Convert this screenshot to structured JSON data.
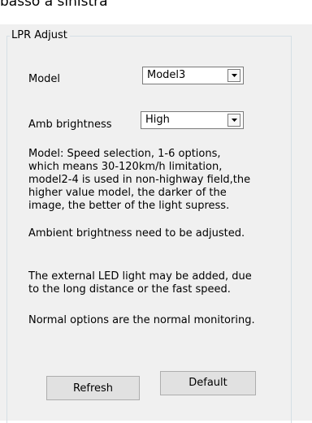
{
  "caption": "basso a sinistra",
  "group": {
    "title": "LPR Adjust"
  },
  "fields": {
    "model_label": "Model",
    "model_value": "Model3",
    "amb_label": "Amb brightness",
    "amb_value": "High"
  },
  "descriptions": {
    "model_lines": [
      "Model: Speed selection, 1-6 options,",
      "which means 30-120km/h limitation,",
      "model2-4 is used in non-highway field,the",
      "higher value model, the darker of the",
      "image, the better of the light supress."
    ],
    "ambient": "Ambient brightness need to be adjusted.",
    "led_lines": [
      "The external LED light may be added, due",
      "to the long distance or the fast speed."
    ],
    "normal": "Normal options are the normal monitoring."
  },
  "buttons": {
    "refresh": "Refresh",
    "default": "Default"
  },
  "icons": {
    "dropdown": "chevron-down-icon"
  }
}
